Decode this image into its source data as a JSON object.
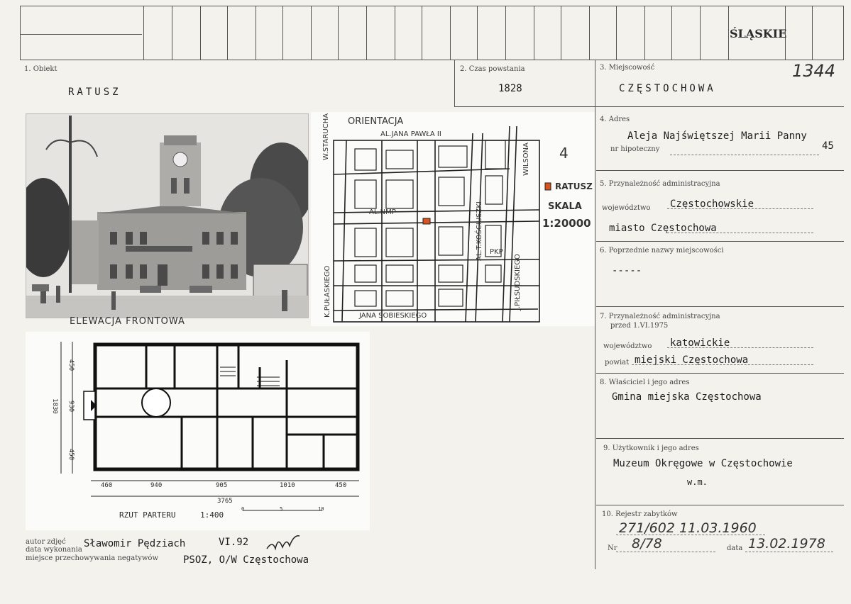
{
  "header": {
    "region": "ŚLĄSKIE"
  },
  "fields": {
    "obiekt": {
      "label": "1. Obiekt",
      "value": "RATUSZ"
    },
    "czas": {
      "label": "2. Czas powstania",
      "value": "1828"
    },
    "miejscowosc": {
      "label": "3. Miejscowość",
      "value": "CZĘSTOCHOWA",
      "number": "1344"
    },
    "adres": {
      "label": "4. Adres",
      "value": "Aleja Najświętszej Marii Panny",
      "hipo_label": "nr hipoteczny",
      "hipo_value": "45"
    },
    "przynaleznosc": {
      "label": "5. Przynależność administracyjna",
      "woj_label": "województwo",
      "woj_value": "Częstochowskie",
      "miasto_value": "miasto Częstochowa"
    },
    "poprzednie": {
      "label": "6. Poprzednie nazwy miejscowości",
      "value": "-----"
    },
    "przed1975": {
      "label1": "7. Przynależność administracyjna",
      "label2": "przed 1.VI.1975",
      "woj_label": "województwo",
      "woj_value": "katowickie",
      "powiat_label": "powiat",
      "powiat_value": "miejski Częstochowa"
    },
    "wlasciciel": {
      "label": "8. Właściciel i jego adres",
      "value": "Gmina miejska Częstochowa"
    },
    "uzytkownik": {
      "label": "9. Użytkownik i jego adres",
      "value": "Muzeum Okręgowe w Częstochowie",
      "extra": "w.m."
    },
    "rejestr": {
      "label": "10. Rejestr zabytków",
      "entry": "271/602 11.03.1960",
      "nr_label": "Nr",
      "nr_value": "8/78",
      "data_label": "data",
      "data_value": "13.02.1978"
    }
  },
  "photo": {
    "caption": "ELEWACJA FRONTOWA"
  },
  "map": {
    "title": "ORIENTACJA",
    "number": "4",
    "legend": "RATUSZ",
    "scale_label": "SKALA",
    "scale_value": "1:20000",
    "streets": [
      "AL.JANA PAWŁA II",
      "W.STARUCHA",
      "AL.NMP",
      "AL.T.KOŚCIUSZKI",
      "WILSONA",
      "K.PUŁASKIEGO",
      "J.PIŁSUDSKIEGO",
      "JANA SOBIESKIEGO",
      "PKP"
    ]
  },
  "plan": {
    "title": "RZUT PARTERU",
    "scale": "1:400",
    "dims_h": [
      "460",
      "940",
      "905",
      "1010",
      "450"
    ],
    "total": "3765",
    "dims_v": [
      "450",
      "930",
      "450"
    ],
    "total_v": "1830",
    "scalebar": [
      "0",
      "5",
      "10"
    ]
  },
  "footer": {
    "autor_label": "autor zdjęć",
    "data_label": "data wykonania",
    "autor_value": "Sławomir Pędziach",
    "date_value": "VI.92",
    "miejsce_label": "miejsce przechowywania negatywów",
    "miejsce_value": "PSOZ, O/W Częstochowa"
  }
}
